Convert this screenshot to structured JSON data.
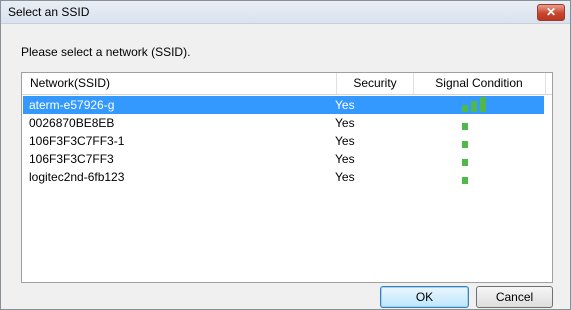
{
  "window": {
    "title": "Select an SSID",
    "close_glyph": "✕"
  },
  "prompt": "Please select a network (SSID).",
  "columns": {
    "network": "Network(SSID)",
    "security": "Security",
    "signal": "Signal Condition"
  },
  "networks": [
    {
      "ssid": "aterm-e57926-g",
      "security": "Yes",
      "signal_bars": 3,
      "selected": true
    },
    {
      "ssid": "0026870BE8EB",
      "security": "Yes",
      "signal_bars": 1,
      "selected": false
    },
    {
      "ssid": "106F3F3C7FF3-1",
      "security": "Yes",
      "signal_bars": 1,
      "selected": false
    },
    {
      "ssid": "106F3F3C7FF3",
      "security": "Yes",
      "signal_bars": 1,
      "selected": false
    },
    {
      "ssid": "logitec2nd-6fb123",
      "security": "Yes",
      "signal_bars": 1,
      "selected": false
    }
  ],
  "buttons": {
    "ok": "OK",
    "cancel": "Cancel"
  },
  "colors": {
    "selection": "#3399ff",
    "signal_bar": "#50b848"
  }
}
